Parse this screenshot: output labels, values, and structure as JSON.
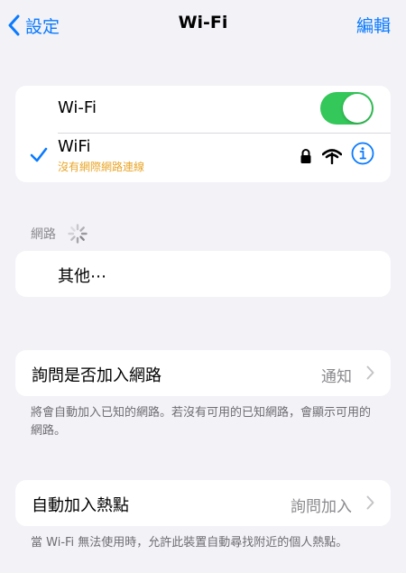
{
  "nav": {
    "back_label": "設定",
    "title": "Wi-Fi",
    "edit_label": "編輯"
  },
  "wifi_card": {
    "toggle_label": "Wi-Fi",
    "toggle_on": true,
    "network_name": "WiFi",
    "network_status": "沒有網際網路連線",
    "icons": [
      "checkmark-icon",
      "lock-icon",
      "wifi-signal-icon",
      "info-icon"
    ]
  },
  "networks": {
    "header": "網路",
    "other_label": "其他⋯"
  },
  "ask_join": {
    "label": "詢問是否加入網路",
    "value": "通知",
    "footer": "將會自動加入已知的網路。若沒有可用的已知網路，會顯示可用的網路。"
  },
  "auto_hotspot": {
    "label": "自動加入熱點",
    "value": "詢問加入",
    "footer": "當 Wi-Fi 無法使用時，允許此裝置自動尋找附近的個人熱點。"
  },
  "colors": {
    "accent": "#0a7aff",
    "toggle_on": "#34c759",
    "warning": "#e9a628",
    "background": "#f2f2f7"
  }
}
